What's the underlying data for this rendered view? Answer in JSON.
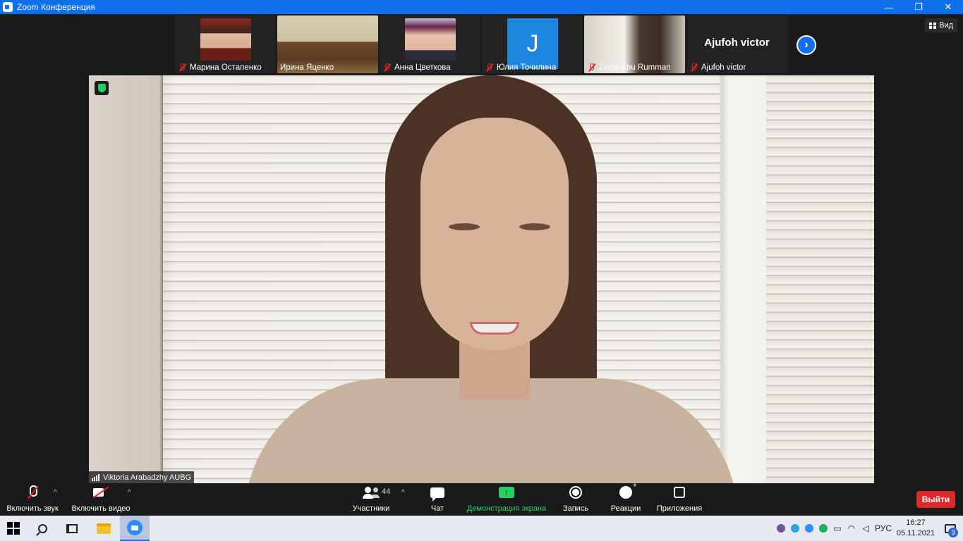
{
  "window": {
    "title": "Zoom Конференция",
    "controls": {
      "minimize": "—",
      "maximize": "❐",
      "close": "✕"
    }
  },
  "gallery": {
    "participants": [
      {
        "name": "Марина Остапенко",
        "muted": true,
        "tile": "video"
      },
      {
        "name": "Ирина Яценко",
        "muted": false,
        "tile": "video"
      },
      {
        "name": "Анна Цветкова",
        "muted": true,
        "tile": "video"
      },
      {
        "name": "Юлия Точилина",
        "muted": true,
        "tile": "initial",
        "initial": "J"
      },
      {
        "name": "Zeina Abu Rumman",
        "muted": true,
        "tile": "video"
      },
      {
        "name": "Ajufoh victor",
        "muted": true,
        "tile": "name",
        "display_name": "Ajufoh victor"
      }
    ],
    "next_icon": "chevron-right-icon",
    "view_button": "Вид"
  },
  "speaker": {
    "name": "Viktoria Arabadzhy AUBG",
    "encryption_icon": "shield-check-icon"
  },
  "toolbar": {
    "mute_label": "Включить звук",
    "video_label": "Включить видео",
    "participants_label": "Участники",
    "participants_count": "44",
    "chat_label": "Чат",
    "share_label": "Демонстрация экрана",
    "record_label": "Запись",
    "reactions_label": "Реакции",
    "apps_label": "Приложения",
    "leave_label": "Выйти",
    "colors": {
      "share": "#23d160",
      "leave": "#e02828",
      "accent": "#0e71eb"
    }
  },
  "taskbar": {
    "language": "РУС",
    "time": "16:27",
    "date": "05.11.2021",
    "notifications_count": "3"
  }
}
